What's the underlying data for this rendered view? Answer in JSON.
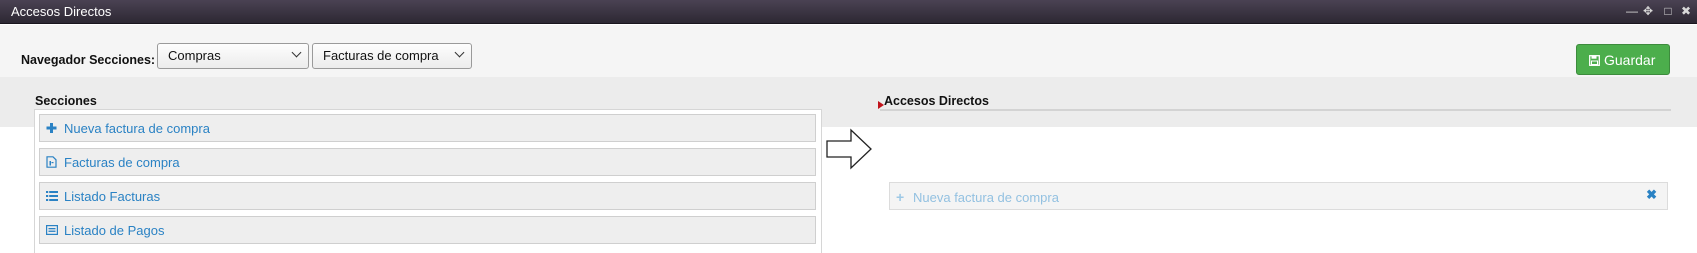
{
  "window": {
    "title": "Accesos Directos",
    "controls": [
      "minimize-icon",
      "move-icon",
      "maximize-icon",
      "close-icon"
    ]
  },
  "navigator": {
    "label": "Navegador Secciones:",
    "section_select": "Compras",
    "subsection_select": "Facturas de compra"
  },
  "toolbar": {
    "save_label": "Guardar",
    "save_icon": "floppy-disk-icon",
    "save_color": "#4cae4c"
  },
  "sections": {
    "title": "Secciones",
    "items": [
      {
        "label": "Nueva factura de compra",
        "icon": "plus-icon"
      },
      {
        "label": "Facturas de compra",
        "icon": "invoice-document-icon"
      },
      {
        "label": "Listado Facturas",
        "icon": "list-icon"
      },
      {
        "label": "Listado de Pagos",
        "icon": "payments-list-icon"
      }
    ]
  },
  "shortcuts": {
    "title": "Accesos Directos",
    "items": [
      {
        "label": "Nueva factura de compra",
        "icon": "plus-icon",
        "remove_icon": "close-x-icon"
      }
    ]
  },
  "colors": {
    "link": "#2a82c4",
    "titlebar": "#3a3441",
    "marker": "#c0131b"
  }
}
